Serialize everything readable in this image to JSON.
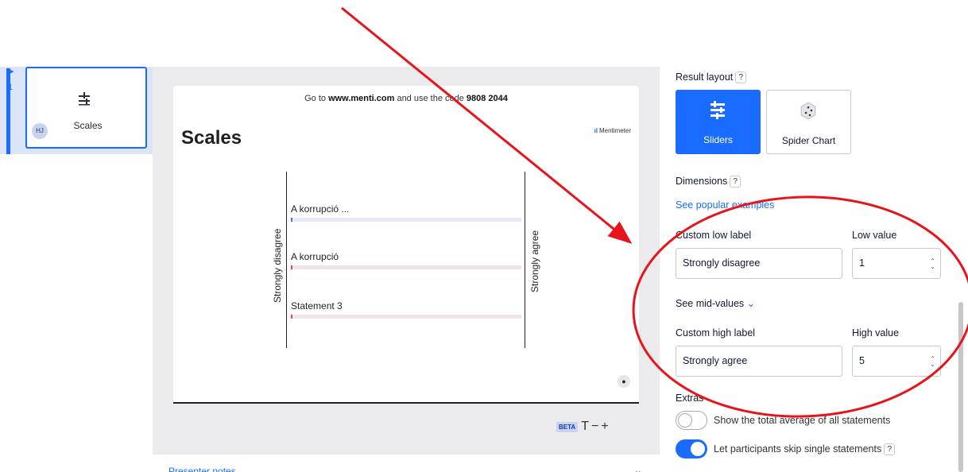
{
  "slides": [
    {
      "number": "1",
      "label": "Scales",
      "avatar": "HJ"
    }
  ],
  "preview": {
    "join_prefix": "Go to ",
    "join_url": "www.menti.com",
    "join_middle": " and use the code ",
    "join_code": "9808 2044",
    "title": "Scales",
    "brand": "Mentimeter",
    "low_label": "Strongly disagree",
    "high_label": "Strongly agree",
    "statements": [
      {
        "label": "A korrupció ...",
        "value": 0,
        "color": "blue"
      },
      {
        "label": "A korrupció",
        "value": 0,
        "color": "red"
      },
      {
        "label": "Statement 3",
        "value": 0,
        "color": "red"
      }
    ]
  },
  "toolbar": {
    "beta": "BETA",
    "text_icon": "T",
    "minus": "−",
    "plus": "+"
  },
  "notes": {
    "label": "Presenter notes"
  },
  "panel": {
    "result_layout_title": "Result layout",
    "help": "?",
    "layouts": [
      {
        "label": "Sliders",
        "icon": "sliders-icon",
        "active": true
      },
      {
        "label": "Spider Chart",
        "icon": "spider-chart-icon",
        "active": false
      }
    ],
    "dimensions_title": "Dimensions",
    "see_popular": "See popular examples",
    "custom_low_label": "Custom low label",
    "low_value_label": "Low value",
    "low_label_value": "Strongly disagree",
    "low_value": "1",
    "see_mid": "See mid-values",
    "custom_high_label": "Custom high label",
    "high_value_label": "High value",
    "high_label_value": "Strongly agree",
    "high_value": "5",
    "extras_title": "Extras",
    "toggles": [
      {
        "label": "Show the total average of all statements",
        "on": false
      },
      {
        "label": "Let participants skip single statements",
        "on": true
      }
    ]
  },
  "colors": {
    "accent": "#196cff",
    "annotation": "#e8141c"
  }
}
